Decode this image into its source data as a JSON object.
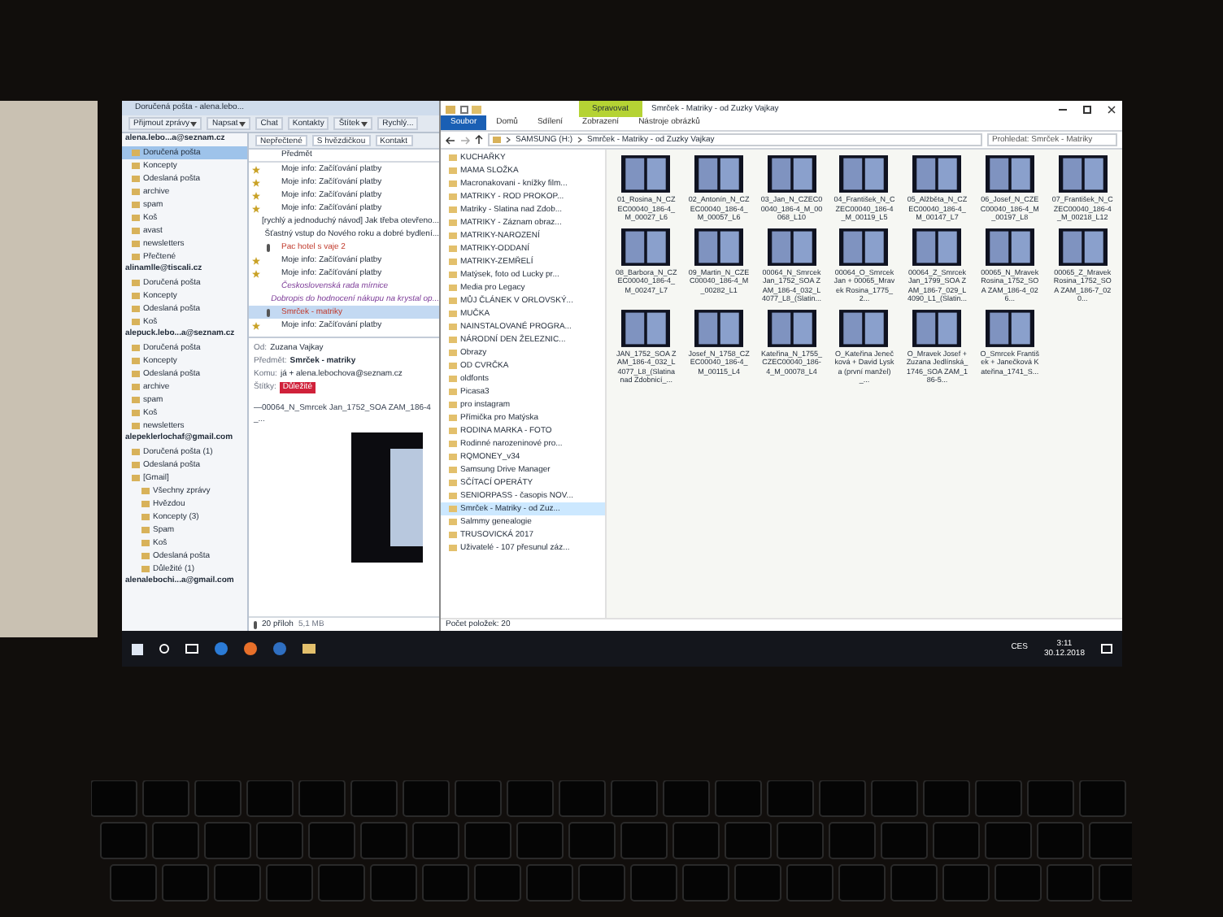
{
  "mail": {
    "title": "Doručená pošta - alena.lebo...",
    "toolbar": [
      {
        "label": "Přijmout zprávy",
        "kind": "dropdown"
      },
      {
        "label": "Napsat",
        "kind": "dropdown"
      },
      {
        "label": "Chat",
        "kind": "plain"
      },
      {
        "label": "Kontakty",
        "kind": "plain"
      },
      {
        "label": "Štítek",
        "kind": "dropdown"
      },
      {
        "label": "Rychlý...",
        "kind": "plain"
      }
    ],
    "accounts": [
      {
        "name": "alena.lebo...a@seznam.cz",
        "folders": [
          {
            "label": "Doručená pošta",
            "selected": true
          },
          {
            "label": "Koncepty",
            "selected": false
          },
          {
            "label": "Odeslaná pošta",
            "selected": false
          },
          {
            "label": "archive",
            "selected": false
          },
          {
            "label": "spam",
            "selected": false
          },
          {
            "label": "Koš",
            "selected": false
          },
          {
            "label": "avast",
            "selected": false
          },
          {
            "label": "newsletters",
            "selected": false
          },
          {
            "label": "Přečtené",
            "selected": false
          }
        ]
      },
      {
        "name": "alinamlle@tiscali.cz",
        "folders": [
          {
            "label": "Doručená pošta",
            "selected": false
          },
          {
            "label": "Koncepty",
            "selected": false
          },
          {
            "label": "Odeslaná pošta",
            "selected": false
          },
          {
            "label": "Koš",
            "selected": false
          }
        ]
      },
      {
        "name": "alepuck.lebo...a@seznam.cz",
        "folders": [
          {
            "label": "Doručená pošta",
            "selected": false
          },
          {
            "label": "Koncepty",
            "selected": false
          },
          {
            "label": "Odeslaná pošta",
            "selected": false
          },
          {
            "label": "archive",
            "selected": false
          },
          {
            "label": "spam",
            "selected": false
          },
          {
            "label": "Koš",
            "selected": false
          },
          {
            "label": "newsletters",
            "selected": false
          }
        ]
      },
      {
        "name": "alepeklerlochaf@gmail.com",
        "folders": [
          {
            "label": "Doručená pošta (1)",
            "selected": false
          },
          {
            "label": "Odeslaná pošta",
            "selected": false
          },
          {
            "label": "[Gmail]",
            "selected": false,
            "children": [
              {
                "label": "Všechny zprávy",
                "selected": false
              },
              {
                "label": "Hvězdou",
                "selected": false
              },
              {
                "label": "Koncepty (3)",
                "selected": false
              },
              {
                "label": "Spam",
                "selected": false
              },
              {
                "label": "Koš",
                "selected": false
              },
              {
                "label": "Odeslaná pošta",
                "selected": false
              },
              {
                "label": "Důležité (1)",
                "selected": false
              }
            ]
          }
        ]
      },
      {
        "name": "alenalebochi...a@gmail.com"
      }
    ],
    "filters": [
      "Nepřečtené",
      "S hvězdičkou",
      "Kontakt"
    ],
    "subject_column": "Předmět",
    "messages": [
      {
        "subject": "Moje info: Začíťování platby",
        "starred": true,
        "attachment": false,
        "selected": false,
        "important": false,
        "flagged": false
      },
      {
        "subject": "Moje info: Začíťování platby",
        "starred": true,
        "attachment": false,
        "selected": false,
        "important": false,
        "flagged": false
      },
      {
        "subject": "Moje info: Začíťování platby",
        "starred": true,
        "attachment": false,
        "selected": false,
        "important": false,
        "flagged": false
      },
      {
        "subject": "Moje info: Začíťování platby",
        "starred": true,
        "attachment": false,
        "selected": false,
        "important": false,
        "flagged": false
      },
      {
        "subject": "[rychlý a jednoduchý návod] Jak třeba otevřeno...",
        "starred": false,
        "attachment": false,
        "selected": false,
        "important": false,
        "flagged": false
      },
      {
        "subject": "Šťastný vstup do Nového roku a dobré bydlení...",
        "starred": false,
        "attachment": false,
        "selected": false,
        "important": false,
        "flagged": false
      },
      {
        "subject": "Pac hotel s vaje 2",
        "starred": false,
        "attachment": true,
        "selected": false,
        "important": true,
        "flagged": false
      },
      {
        "subject": "Moje info: Začíťování platby",
        "starred": true,
        "attachment": false,
        "selected": false,
        "important": false,
        "flagged": false
      },
      {
        "subject": "Moje info: Začíťování platby",
        "starred": true,
        "attachment": false,
        "selected": false,
        "important": false,
        "flagged": false
      },
      {
        "subject": "Československá rada mírnice",
        "starred": false,
        "attachment": false,
        "selected": false,
        "important": false,
        "flagged": true
      },
      {
        "subject": "Dobropis do hodnocení nákupu na krystal op...",
        "starred": false,
        "attachment": false,
        "selected": false,
        "important": false,
        "flagged": true
      },
      {
        "subject": "Smrček - matriky",
        "starred": false,
        "attachment": true,
        "selected": true,
        "important": true,
        "flagged": false
      },
      {
        "subject": "Moje info: Začíťování platby",
        "starred": true,
        "attachment": false,
        "selected": false,
        "important": false,
        "flagged": false
      }
    ],
    "header": [
      {
        "label": "Od:",
        "value": "Zuzana Vajkay",
        "kind": "text"
      },
      {
        "label": "Předmět:",
        "value": "Smrček - matriky",
        "kind": "bold"
      },
      {
        "label": "Komu:",
        "value": "já + alena.lebochova@seznam.cz",
        "kind": "text"
      },
      {
        "label": "Štítky:",
        "value": "Důležité",
        "kind": "tag"
      }
    ],
    "body_line": "—00064_N_Smrcek Jan_1752_SOA ZAM_186-4_...",
    "attachments": "20 příloh",
    "attachments_size": "5,1 MB"
  },
  "explorer": {
    "manage_tab": "Spravovat",
    "title": "Smrček - Matriky - od Zuzky Vajkay",
    "tabs": [
      {
        "label": "Soubor",
        "selected": true
      },
      {
        "label": "Domů",
        "selected": false
      },
      {
        "label": "Sdílení",
        "selected": false
      },
      {
        "label": "Zobrazení",
        "selected": false
      },
      {
        "label": "Nástroje obrázků",
        "selected": false
      }
    ],
    "path": [
      "SAMSUNG (H:)",
      "Smrček - Matriky - od Zuzky Vajkay"
    ],
    "search": {
      "placeholder": "Prohledat: Smrček - Matriky"
    },
    "nav": [
      {
        "label": "KUCHAŘKY",
        "selected": false
      },
      {
        "label": "MAMA SLOŽKA",
        "selected": false
      },
      {
        "label": "Macronakovani - knížky film...",
        "selected": false
      },
      {
        "label": "MATRIKY - ROD PROKOP...",
        "selected": false
      },
      {
        "label": "Matriky - Slatina nad Zdob...",
        "selected": false
      },
      {
        "label": "MATRIKY - Záznam obraz...",
        "selected": false
      },
      {
        "label": "MATRIKY-NAROZENÍ",
        "selected": false
      },
      {
        "label": "MATRIKY-ODDANÍ",
        "selected": false
      },
      {
        "label": "MATRIKY-ZEMŘELÍ",
        "selected": false
      },
      {
        "label": "Matýsek, foto od Lucky pr...",
        "selected": false
      },
      {
        "label": "Media pro Legacy",
        "selected": false
      },
      {
        "label": "MŮJ ČLÁNEK V ORLOVSKÝ...",
        "selected": false
      },
      {
        "label": "MUČKA",
        "selected": false
      },
      {
        "label": "NAINSTALOVANÉ PROGRA...",
        "selected": false
      },
      {
        "label": "NÁRODNÍ DEN ŽELEZNIC...",
        "selected": false
      },
      {
        "label": "Obrazy",
        "selected": false
      },
      {
        "label": "OD CVRČKA",
        "selected": false
      },
      {
        "label": "oldfonts",
        "selected": false
      },
      {
        "label": "Picasa3",
        "selected": false
      },
      {
        "label": "pro instagram",
        "selected": false
      },
      {
        "label": "Přímička pro Matýska",
        "selected": false
      },
      {
        "label": "RODINA MARKA - FOTO",
        "selected": false
      },
      {
        "label": "Rodinné narozeninové pro...",
        "selected": false
      },
      {
        "label": "RQMONEY_v34",
        "selected": false
      },
      {
        "label": "Samsung Drive Manager",
        "selected": false
      },
      {
        "label": "SČÍTACÍ OPERÁTY",
        "selected": false
      },
      {
        "label": "SENIORPASS - časopis NOV...",
        "selected": false
      },
      {
        "label": "Smrček - Matriky - od Zuz...",
        "selected": true
      },
      {
        "label": "Salmmy genealogie",
        "selected": false
      },
      {
        "label": "TRUSOVICKÁ 2017",
        "selected": false
      },
      {
        "label": "Uživatelé - 107 přesunul záz...",
        "selected": false
      }
    ],
    "files": [
      "01_Rosina_N_CZEC00040_186-4_M_00027_L6",
      "02_Antonín_N_CZEC00040_186-4_M_00057_L6",
      "03_Jan_N_CZEC00040_186-4_M_00068_L10",
      "04_František_N_CZEC00040_186-4_M_00119_L5",
      "05_Alžběta_N_CZEC00040_186-4_M_00147_L7",
      "06_Josef_N_CZEC00040_186-4_M_00197_L8",
      "07_František_N_CZEC00040_186-4_M_00218_L12",
      "08_Barbora_N_CZEC00040_186-4_M_00247_L7",
      "09_Martin_N_CZEC00040_186-4_M_00282_L1",
      "00064_N_Smrcek Jan_1752_SOA ZAM_186-4_032_L4077_L8_(Slatin...",
      "00064_O_Smrcek Jan + 00065_Mravek Rosina_1775_2...",
      "00064_Z_Smrcek Jan_1799_SOA ZAM_186-7_029_L4090_L1_(Slatin...",
      "00065_N_Mravek Rosina_1752_SOA ZAM_186-4_026...",
      "00065_Z_Mravek Rosina_1752_SOA ZAM_186-7_020...",
      "JAN_1752_SOA ZAM_186-4_032_L4077_L8_(Slatina nad Zdobnicí_...",
      "Josef_N_1758_CZEC00040_186-4_M_00115_L4",
      "Kateřina_N_1755_CZEC00040_186-4_M_00078_L4",
      "O_Kateřina Jenečková + David Lyska (první manžel)_...",
      "O_Mravek Josef + Zuzana Jedlínská_1746_SOA ZAM_186-5...",
      "O_Smrcek František + Janečková Kateřina_1741_S..."
    ],
    "status": "Počet položek: 20"
  },
  "taskbar": {
    "language": "CES",
    "time": "3:11",
    "date": "30.12.2018"
  }
}
